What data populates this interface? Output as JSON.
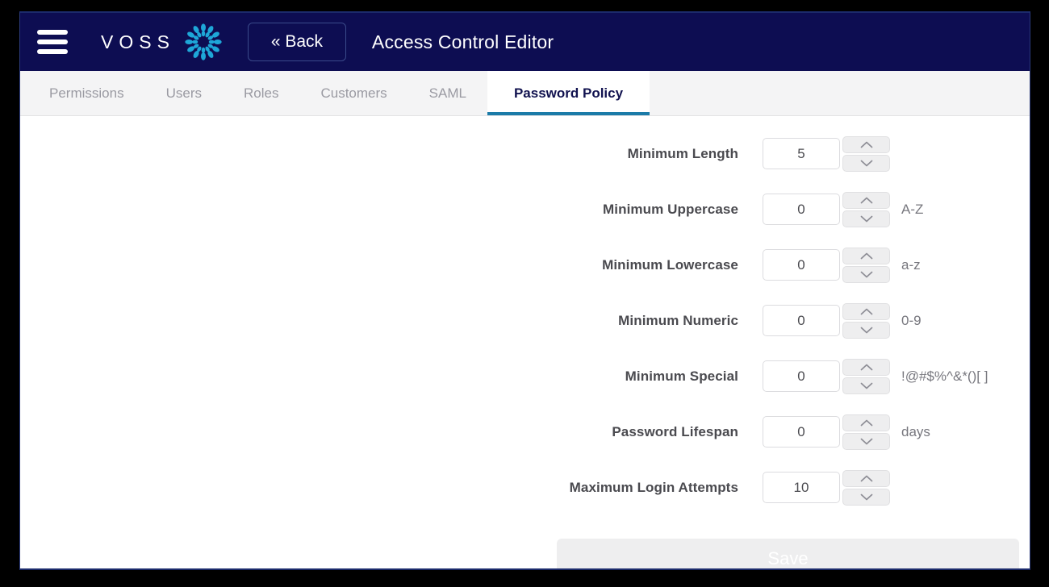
{
  "header": {
    "menu_icon": "hamburger-menu-icon",
    "brand_wordmark": "VOSS",
    "brand_logo_icon": "voss-petal-logo-icon",
    "back_label": "« Back",
    "title": "Access Control Editor",
    "background_color": "#0d0d52"
  },
  "tabs": [
    {
      "label": "Permissions",
      "active": false
    },
    {
      "label": "Users",
      "active": false
    },
    {
      "label": "Roles",
      "active": false
    },
    {
      "label": "Customers",
      "active": false
    },
    {
      "label": "SAML",
      "active": false
    },
    {
      "label": "Password Policy",
      "active": true
    }
  ],
  "active_tab_indicator_color": "#1b7ba8",
  "form": {
    "fields": [
      {
        "label": "Minimum Length",
        "value": "5",
        "hint": ""
      },
      {
        "label": "Minimum Uppercase",
        "value": "0",
        "hint": "A-Z"
      },
      {
        "label": "Minimum Lowercase",
        "value": "0",
        "hint": "a-z"
      },
      {
        "label": "Minimum Numeric",
        "value": "0",
        "hint": "0-9"
      },
      {
        "label": "Minimum Special",
        "value": "0",
        "hint": "!@#$%^&*()[ ]"
      },
      {
        "label": "Password Lifespan",
        "value": "0",
        "hint": "days"
      },
      {
        "label": "Maximum Login Attempts",
        "value": "10",
        "hint": ""
      }
    ],
    "spin_up_icon": "chevron-up-icon",
    "spin_down_icon": "chevron-down-icon",
    "save_label": "Save"
  }
}
